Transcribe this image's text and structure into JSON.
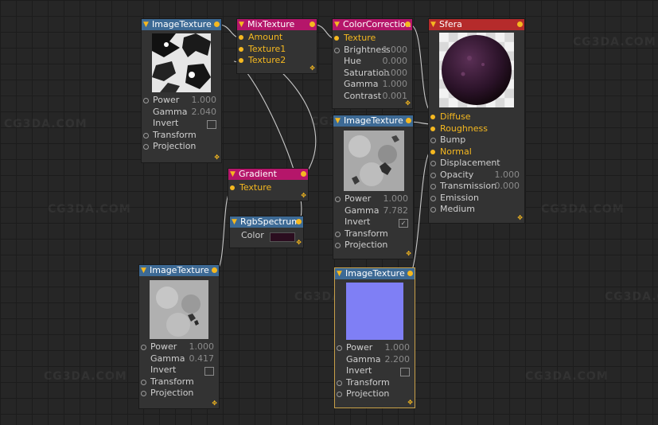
{
  "watermark": "CG3DA.COM",
  "colors": {
    "canvas": "#262626",
    "node_body": "#333333",
    "header_blue": "#3d6a95",
    "header_pink": "#b5166a",
    "header_red": "#b52b2b",
    "port": "#f5b820",
    "wire": "#c8c8c8",
    "rgb_color": "#2b0d1f"
  },
  "nodes": {
    "imgtex1": {
      "title": "ImageTexture",
      "power_label": "Power",
      "power": "1.000",
      "gamma_label": "Gamma",
      "gamma": "2.040",
      "invert_label": "Invert",
      "invert_checked": false,
      "transform_label": "Transform",
      "projection_label": "Projection"
    },
    "mix": {
      "title": "MixTexture",
      "amount_label": "Amount",
      "tex1_label": "Texture1",
      "tex2_label": "Texture2"
    },
    "cc": {
      "title": "ColorCorrection",
      "texture_label": "Texture",
      "brightness_label": "Brightness",
      "brightness": "1.000",
      "hue_label": "Hue",
      "hue": "0.000",
      "saturation_label": "Saturation",
      "saturation": "1.000",
      "gamma_label": "Gamma",
      "gamma": "1.000",
      "contrast_label": "Contrast",
      "contrast": "0.001"
    },
    "sfera": {
      "title": "Sfera",
      "diffuse_label": "Diffuse",
      "roughness_label": "Roughness",
      "bump_label": "Bump",
      "normal_label": "Normal",
      "displacement_label": "Displacement",
      "opacity_label": "Opacity",
      "opacity": "1.000",
      "transmission_label": "Transmission",
      "transmission": "0.000",
      "emission_label": "Emission",
      "medium_label": "Medium"
    },
    "gradient": {
      "title": "Gradient",
      "texture_label": "Texture"
    },
    "rgb": {
      "title": "RgbSpectrum",
      "color_label": "Color"
    },
    "imgtex2": {
      "title": "ImageTexture",
      "power_label": "Power",
      "power": "1.000",
      "gamma_label": "Gamma",
      "gamma": "7.782",
      "invert_label": "Invert",
      "invert_checked": true,
      "transform_label": "Transform",
      "projection_label": "Projection"
    },
    "imgtex3": {
      "title": "ImageTexture",
      "power_label": "Power",
      "power": "1.000",
      "gamma_label": "Gamma",
      "gamma": "0.417",
      "invert_label": "Invert",
      "invert_checked": false,
      "transform_label": "Transform",
      "projection_label": "Projection"
    },
    "imgtex4": {
      "title": "ImageTexture",
      "power_label": "Power",
      "power": "1.000",
      "gamma_label": "Gamma",
      "gamma": "2.200",
      "invert_label": "Invert",
      "invert_checked": false,
      "transform_label": "Transform",
      "projection_label": "Projection"
    }
  }
}
